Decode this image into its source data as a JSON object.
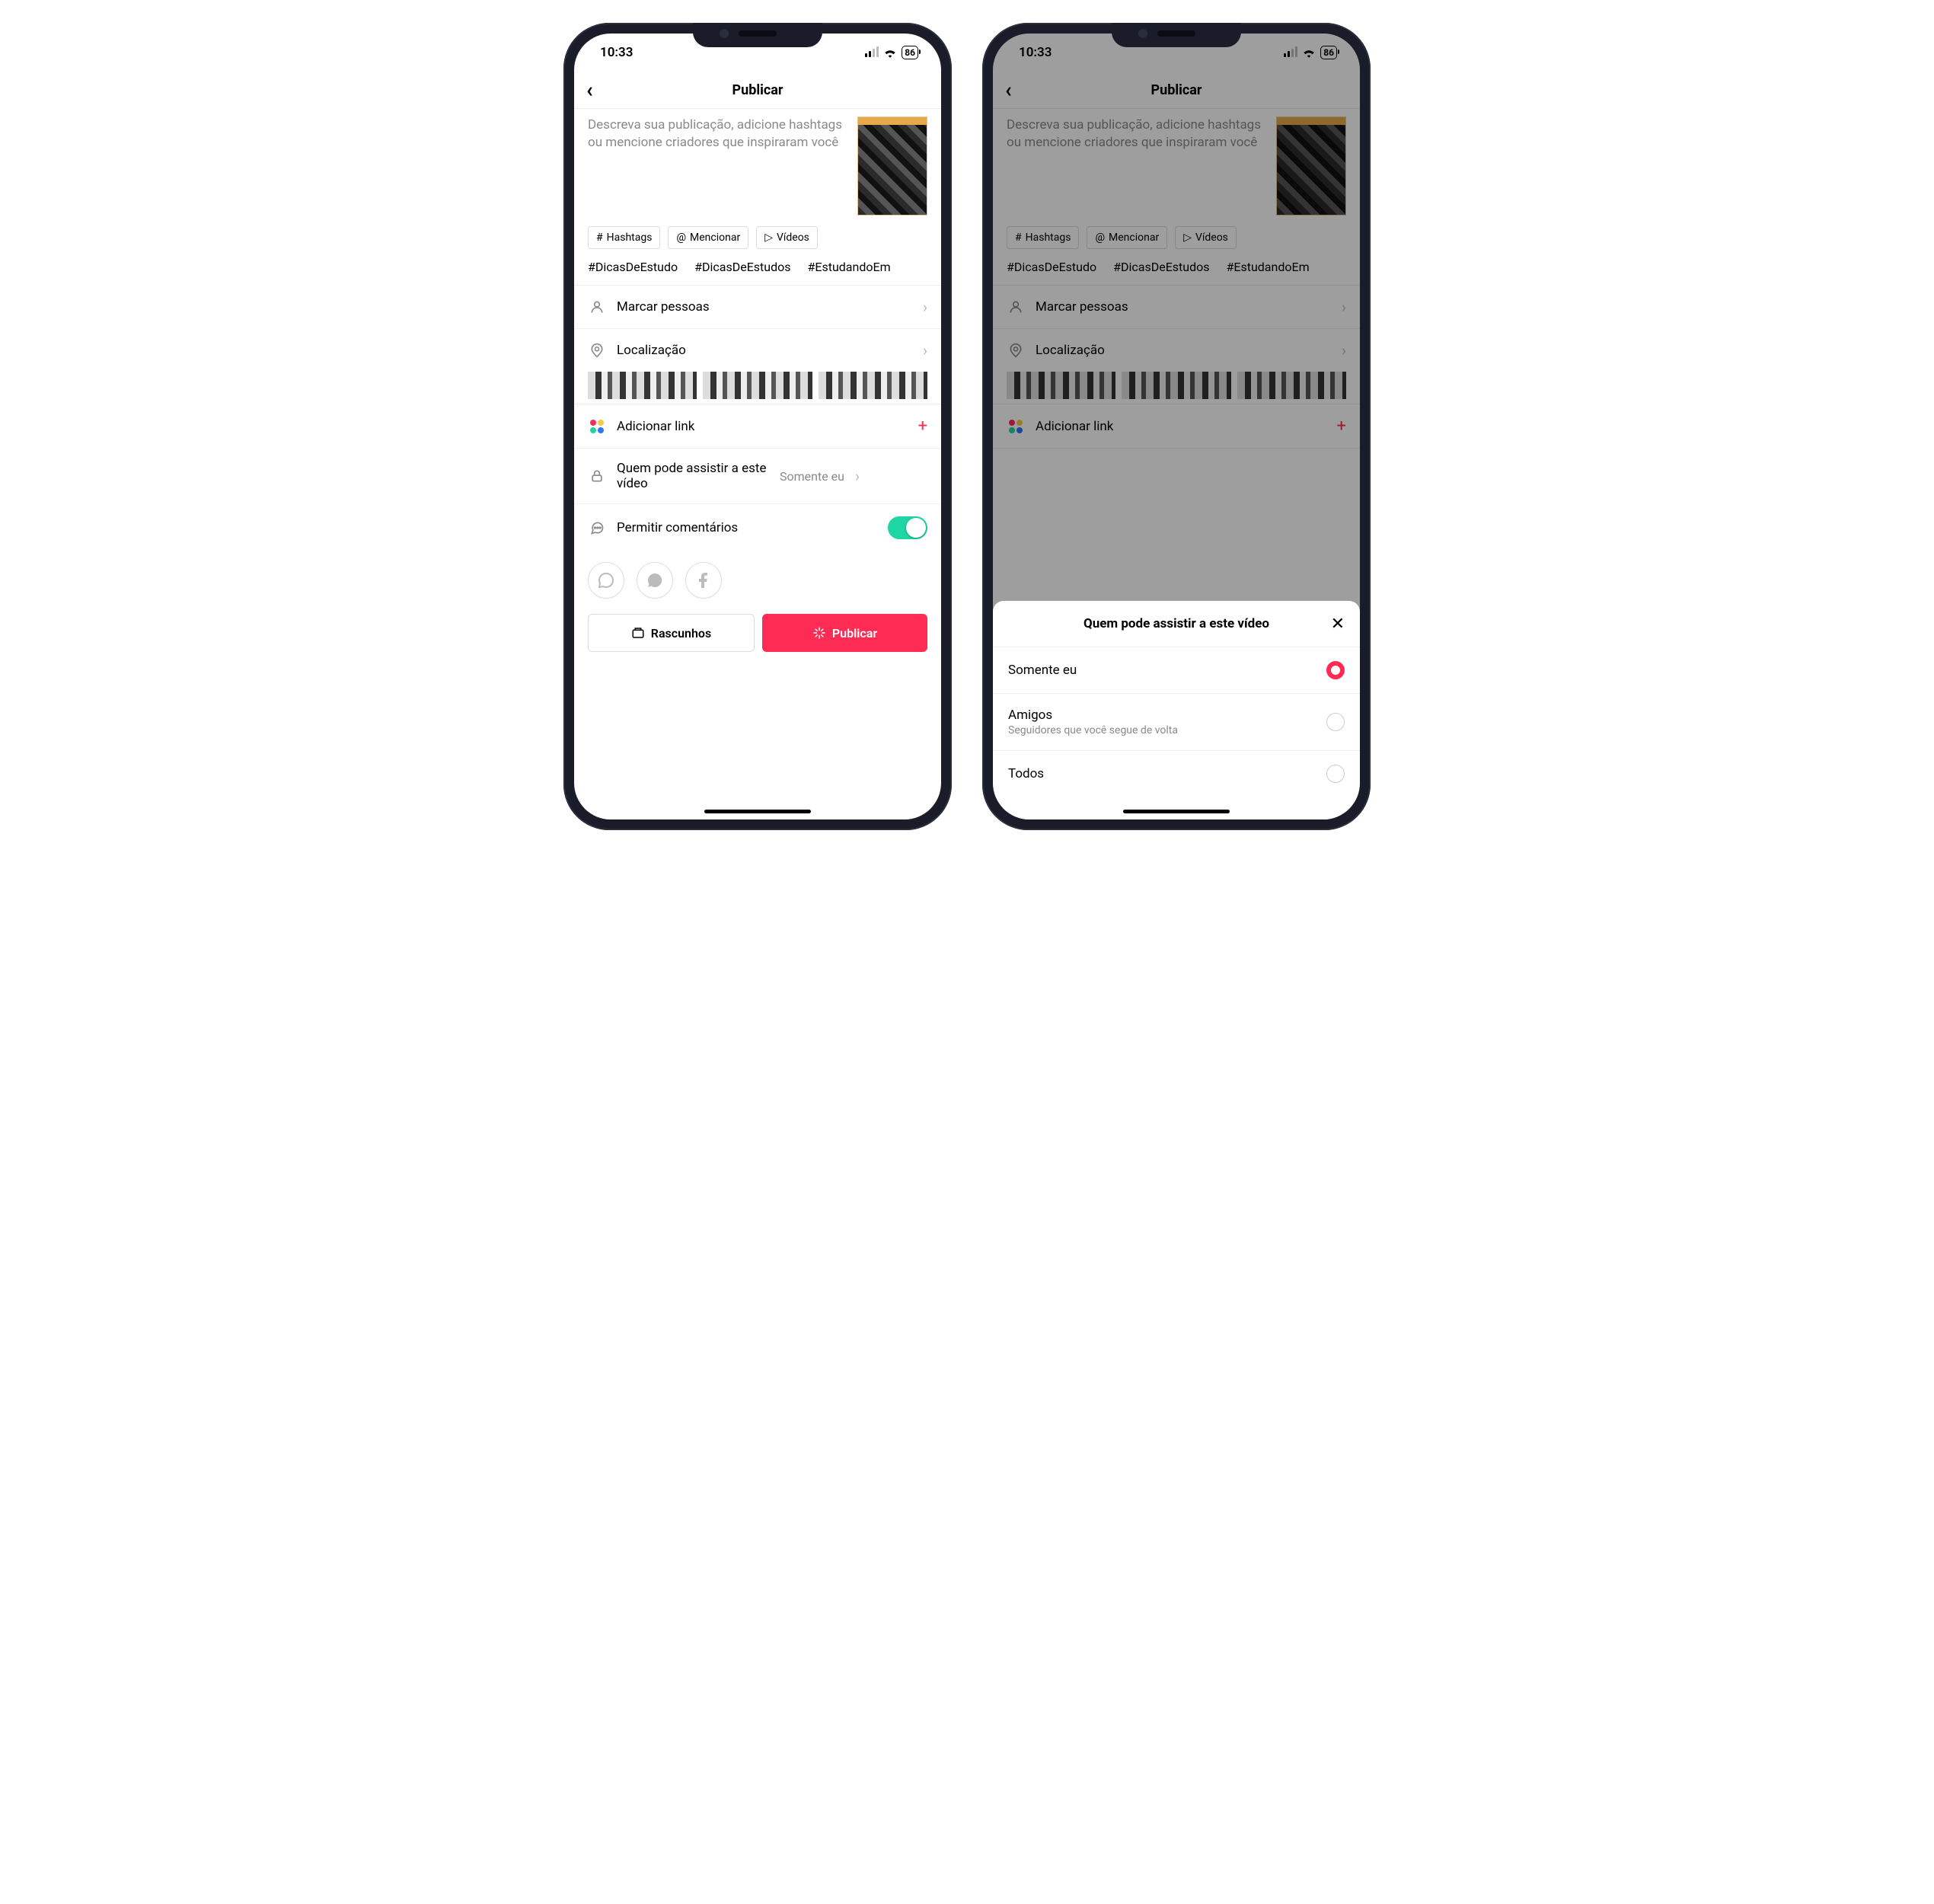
{
  "status": {
    "time": "10:33",
    "battery": "86"
  },
  "header": {
    "title": "Publicar"
  },
  "compose": {
    "placeholder": "Descreva sua publicação, adicione hashtags ou mencione criadores que inspiraram você"
  },
  "chips": {
    "hashtags": "Hashtags",
    "mention": "Mencionar",
    "videos": "Vídeos"
  },
  "hashtag_suggestions": [
    "#DicasDeEstudo",
    "#DicasDeEstudos",
    "#EstudandoEm"
  ],
  "rows": {
    "tag_people": "Marcar pessoas",
    "location": "Localização",
    "add_link": "Adicionar link",
    "privacy_label": "Quem pode assistir a este vídeo",
    "privacy_value": "Somente eu",
    "comments": "Permitir comentários"
  },
  "buttons": {
    "drafts": "Rascunhos",
    "publish": "Publicar"
  },
  "sheet": {
    "title": "Quem pode assistir a este vídeo",
    "options": [
      {
        "label": "Somente eu",
        "sub": "",
        "selected": true
      },
      {
        "label": "Amigos",
        "sub": "Seguidores que você segue de volta",
        "selected": false
      },
      {
        "label": "Todos",
        "sub": "",
        "selected": false
      }
    ]
  }
}
